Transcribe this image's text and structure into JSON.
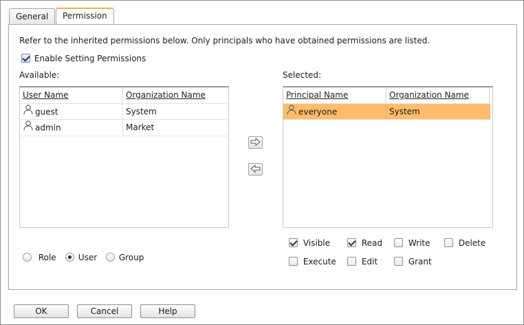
{
  "tabs": [
    {
      "label": "General",
      "active": false
    },
    {
      "label": "Permission",
      "active": true
    }
  ],
  "description": "Refer to the inherited permissions below. Only principals who have obtained permissions are listed.",
  "enable_setting": {
    "label": "Enable Setting Permissions",
    "checked": true
  },
  "available": {
    "label": "Available:",
    "columns": [
      "User Name",
      "Organization Name"
    ],
    "rows": [
      {
        "icon": "user-icon",
        "name": "guest",
        "org": "System"
      },
      {
        "icon": "user-icon",
        "name": "admin",
        "org": "Market"
      }
    ]
  },
  "selected": {
    "label": "Selected:",
    "columns": [
      "Principal Name",
      "Organization Name"
    ],
    "rows": [
      {
        "icon": "user-icon",
        "name": "everyone",
        "org": "System",
        "selected": true
      }
    ]
  },
  "principal_type": {
    "options": [
      {
        "label": "Role",
        "checked": false
      },
      {
        "label": "User",
        "checked": true
      },
      {
        "label": "Group",
        "checked": false
      }
    ]
  },
  "permissions": [
    {
      "label": "Visible",
      "checked": true
    },
    {
      "label": "Read",
      "checked": true
    },
    {
      "label": "Write",
      "checked": false
    },
    {
      "label": "Delete",
      "checked": false
    },
    {
      "label": "Execute",
      "checked": false
    },
    {
      "label": "Edit",
      "checked": false
    },
    {
      "label": "Grant",
      "checked": false
    }
  ],
  "buttons": {
    "ok": "OK",
    "cancel": "Cancel",
    "help": "Help"
  },
  "colors": {
    "selection": "#ffbd6b",
    "active_tab_accent": "#f0b04a"
  }
}
